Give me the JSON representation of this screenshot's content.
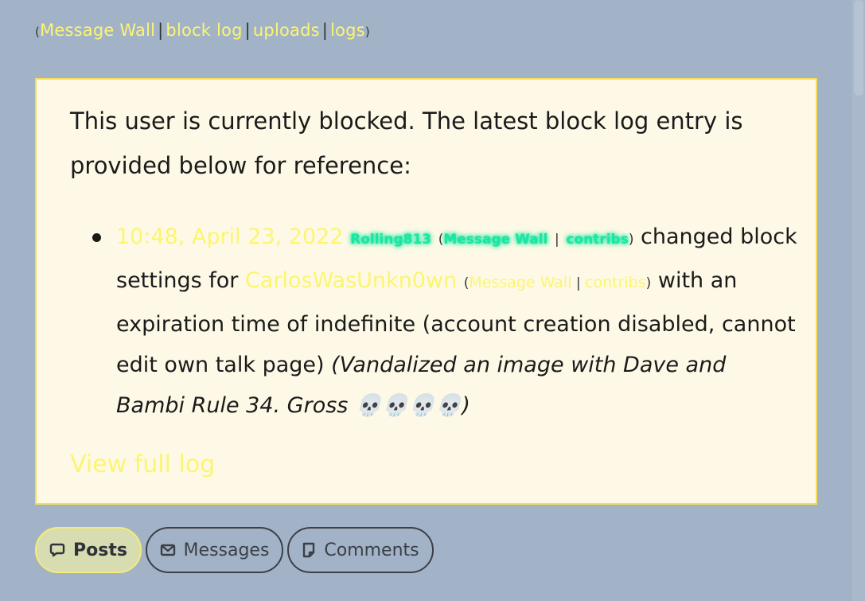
{
  "user_links": {
    "open_paren": "(",
    "message_wall": "Message Wall",
    "block_log": "block log",
    "uploads": "uploads",
    "logs": "logs",
    "separator": "|",
    "close_paren": ")"
  },
  "block_notice": {
    "intro": "This user is currently blocked. The latest block log entry is provided below for reference:",
    "entry": {
      "timestamp": "10:48, April 23, 2022",
      "admin": "Rolling813",
      "admin_message_wall": "Message Wall",
      "admin_contribs": "contribs",
      "action_text": "changed block settings for",
      "target_user": "CarlosWasUnkn0wn",
      "target_message_wall": "Message Wall",
      "target_contribs": "contribs",
      "details": "with an expiration time of indefinite (account creation disabled, cannot edit own talk page)",
      "reason": "(Vandalized an image with Dave and Bambi Rule 34. Gross 💀💀💀💀)"
    },
    "view_full_log": "View full log"
  },
  "tabs": [
    {
      "label": "Posts",
      "icon": "speech-bubble-icon",
      "active": true
    },
    {
      "label": "Messages",
      "icon": "envelope-icon",
      "active": false
    },
    {
      "label": "Comments",
      "icon": "note-icon",
      "active": false
    }
  ],
  "colors": {
    "background": "#a3b3c7",
    "link": "#fcf570",
    "notice_bg": "#fef9e7",
    "notice_border": "#f6df56",
    "glow_link": "#19e6a0"
  }
}
